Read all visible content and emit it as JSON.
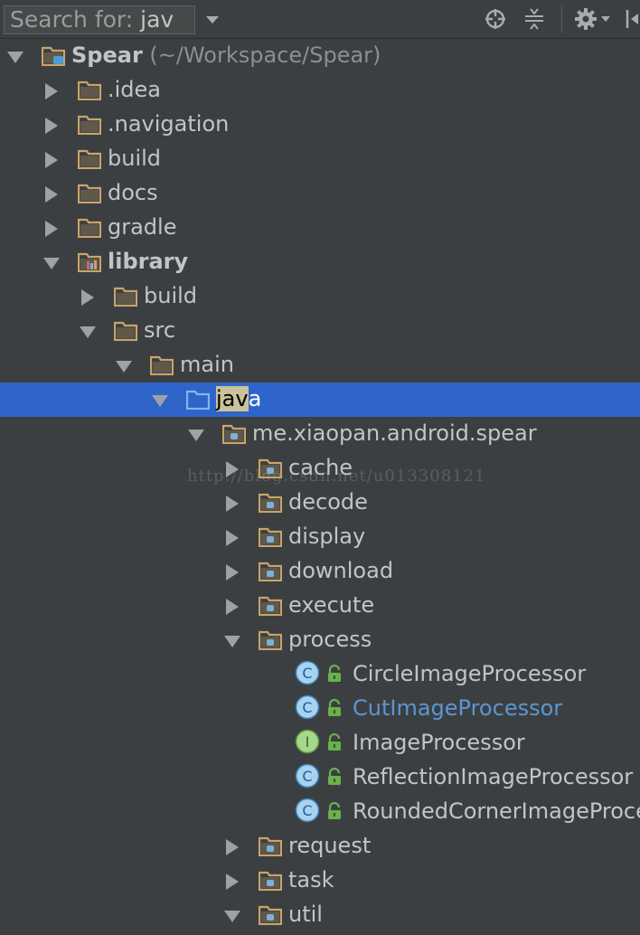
{
  "search": {
    "label": "Search for:",
    "query": "jav"
  },
  "toolbar": {
    "icons": [
      "crosshair-icon",
      "collapse-all-icon",
      "gear-icon",
      "hide-icon"
    ]
  },
  "colors": {
    "background": "#3c3f41",
    "selection": "#2f65ca",
    "folder": "#c8a46a",
    "class_badge": "#a8d3f0",
    "interface_badge": "#a6d88b",
    "link_text": "#5b96d3"
  },
  "watermark": "http://blog.csdn.net/u013308121",
  "tree": [
    {
      "label": "Spear",
      "sub": " (~/Workspace/Spear)",
      "bold": true,
      "icon": "project-icon",
      "expanded": true
    },
    {
      "label": ".idea",
      "icon": "folder-icon",
      "expanded": false
    },
    {
      "label": ".navigation",
      "icon": "folder-icon",
      "expanded": false
    },
    {
      "label": "build",
      "icon": "folder-icon",
      "expanded": false
    },
    {
      "label": "docs",
      "icon": "folder-icon",
      "expanded": false
    },
    {
      "label": "gradle",
      "icon": "folder-icon",
      "expanded": false
    },
    {
      "label": "library",
      "bold": true,
      "icon": "module-folder-icon",
      "expanded": true
    },
    {
      "label": "build",
      "icon": "folder-icon",
      "expanded": false
    },
    {
      "label": "src",
      "icon": "folder-icon",
      "expanded": true
    },
    {
      "label": "main",
      "icon": "folder-icon",
      "expanded": true
    },
    {
      "label_match": "jav",
      "label_rest": "a",
      "icon": "source-folder-icon",
      "expanded": true,
      "selected": true
    },
    {
      "label": "me.xiaopan.android.spear",
      "icon": "package-icon",
      "expanded": true
    },
    {
      "label": "cache",
      "icon": "package-icon",
      "expanded": false
    },
    {
      "label": "decode",
      "icon": "package-icon",
      "expanded": false
    },
    {
      "label": "display",
      "icon": "package-icon",
      "expanded": false
    },
    {
      "label": "download",
      "icon": "package-icon",
      "expanded": false
    },
    {
      "label": "execute",
      "icon": "package-icon",
      "expanded": false
    },
    {
      "label": "process",
      "icon": "package-icon",
      "expanded": true
    },
    {
      "label": "CircleImageProcessor",
      "icon": "class-icon",
      "badge": "C"
    },
    {
      "label": "CutImageProcessor",
      "icon": "class-icon",
      "badge": "C",
      "blue": true
    },
    {
      "label": "ImageProcessor",
      "icon": "interface-icon",
      "badge": "I"
    },
    {
      "label": "ReflectionImageProcessor",
      "icon": "class-icon",
      "badge": "C"
    },
    {
      "label": "RoundedCornerImageProce",
      "icon": "class-icon",
      "badge": "C"
    },
    {
      "label": "request",
      "icon": "package-icon",
      "expanded": false
    },
    {
      "label": "task",
      "icon": "package-icon",
      "expanded": false
    },
    {
      "label": "util",
      "icon": "package-icon",
      "expanded": true
    }
  ]
}
